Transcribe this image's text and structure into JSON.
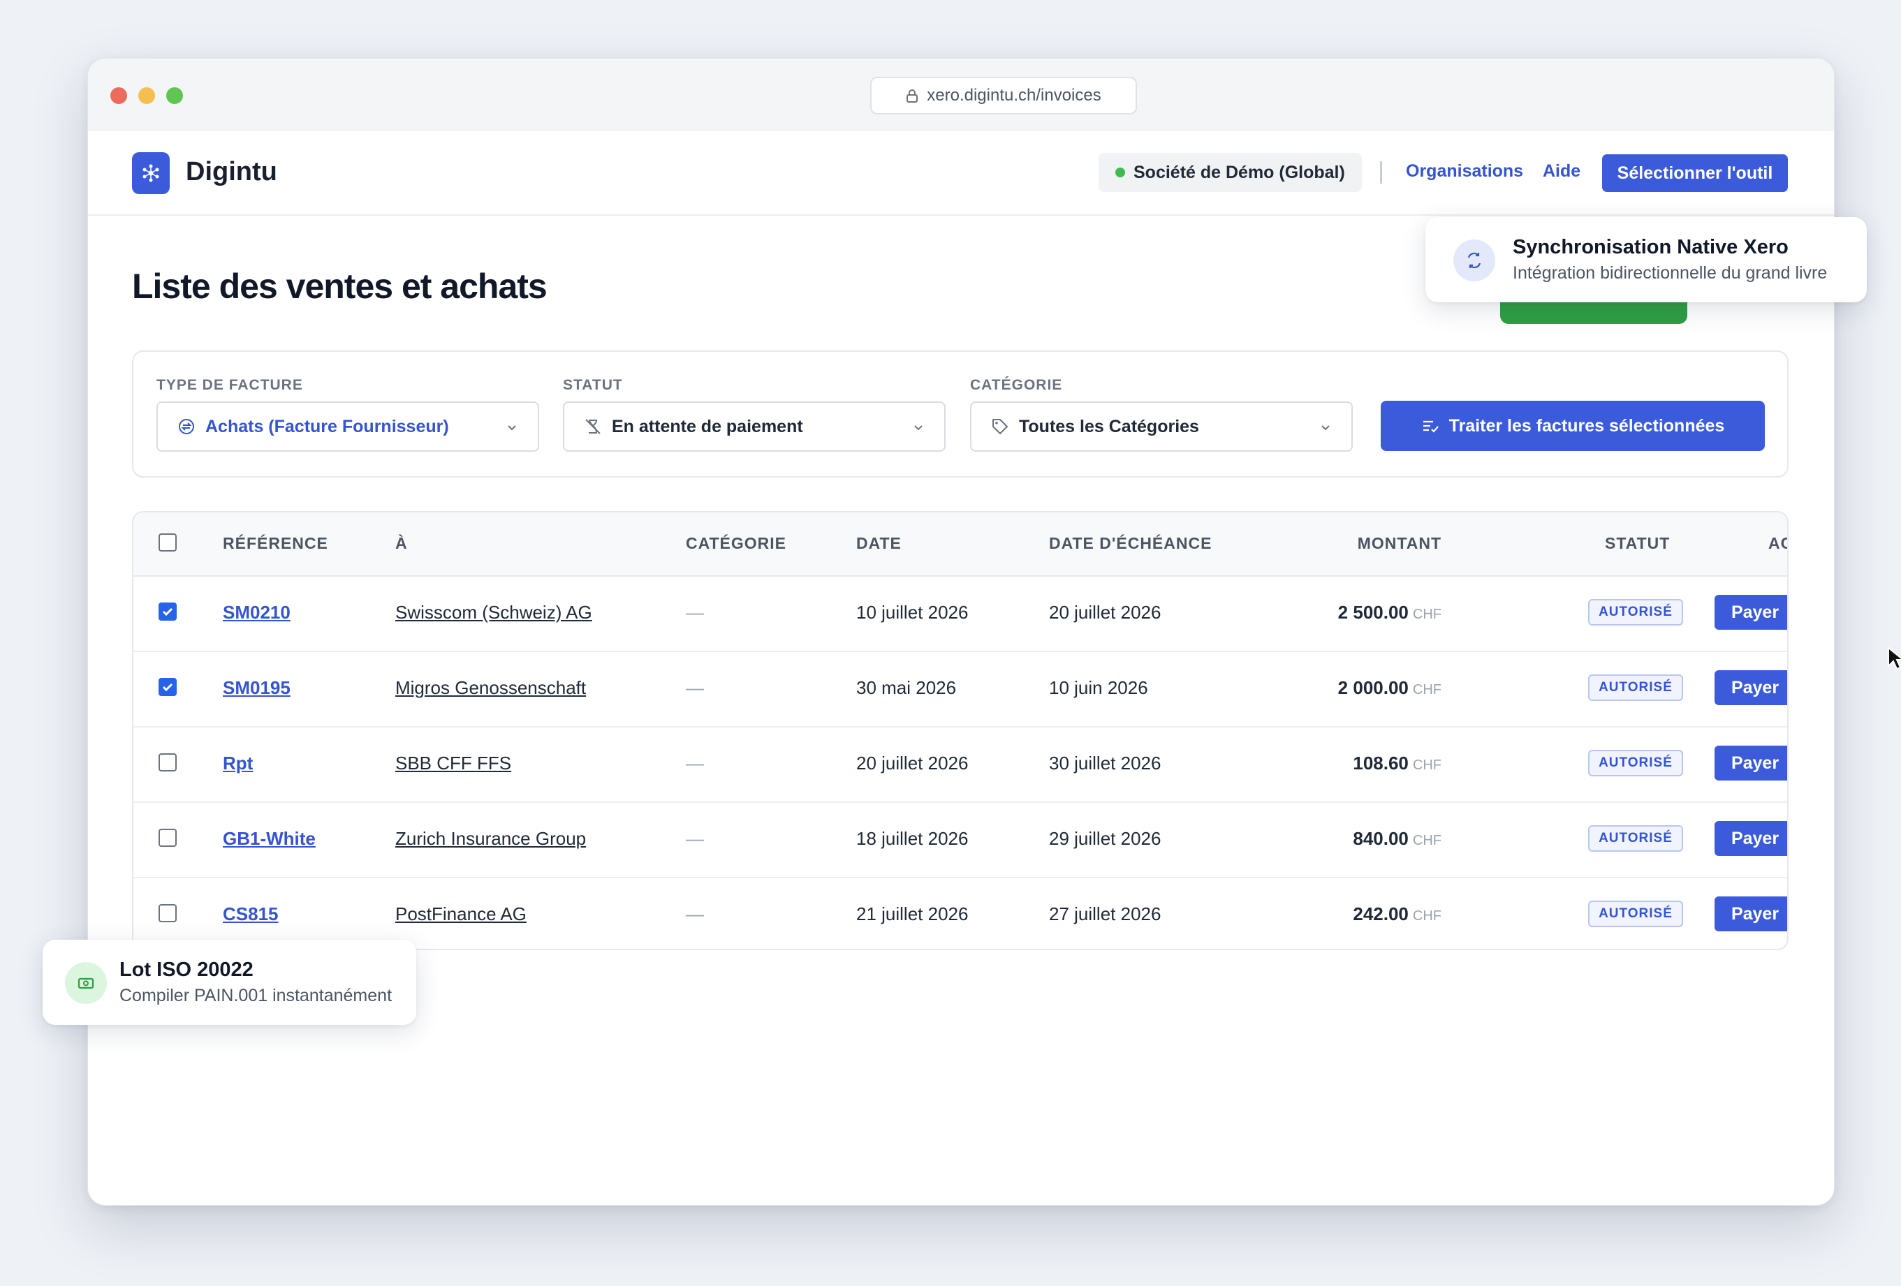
{
  "browser": {
    "url": "xero.digintu.ch/invoices"
  },
  "header": {
    "brand": "Digintu",
    "org": "Société de Démo (Global)",
    "links": {
      "organisations": "Organisations",
      "aide": "Aide"
    },
    "select_tool": "Sélectionner l'outil"
  },
  "page": {
    "title": "Liste des ventes et achats"
  },
  "filters": {
    "invoice_type": {
      "label": "TYPE DE FACTURE",
      "value": "Achats (Facture Fournisseur)"
    },
    "status": {
      "label": "STATUT",
      "value": "En attente de paiement"
    },
    "category": {
      "label": "CATÉGORIE",
      "value": "Toutes les Catégories"
    },
    "process_button": "Traiter les factures sélectionnées"
  },
  "table": {
    "headers": {
      "reference": "RÉFÉRENCE",
      "to": "À",
      "category": "CATÉGORIE",
      "date": "DATE",
      "due": "DATE D'ÉCHÉANCE",
      "amount": "MONTANT",
      "status": "STATUT",
      "action": "ACTION"
    },
    "rows": [
      {
        "checked": true,
        "ref": "SM0210",
        "to": "Swisscom (Schweiz) AG",
        "category": "—",
        "date": "10 juillet 2026",
        "due": "20 juillet 2026",
        "amount": "2 500.00",
        "currency": "CHF",
        "status": "AUTORISÉ",
        "action": "Payer"
      },
      {
        "checked": true,
        "ref": "SM0195",
        "to": "Migros Genossenschaft",
        "category": "—",
        "date": "30 mai 2026",
        "due": "10 juin 2026",
        "amount": "2 000.00",
        "currency": "CHF",
        "status": "AUTORISÉ",
        "action": "Payer"
      },
      {
        "checked": false,
        "ref": "Rpt",
        "to": "SBB CFF FFS",
        "category": "—",
        "date": "20 juillet 2026",
        "due": "30 juillet 2026",
        "amount": "108.60",
        "currency": "CHF",
        "status": "AUTORISÉ",
        "action": "Payer"
      },
      {
        "checked": false,
        "ref": "GB1-White",
        "to": "Zurich Insurance Group",
        "category": "—",
        "date": "18 juillet 2026",
        "due": "29 juillet 2026",
        "amount": "840.00",
        "currency": "CHF",
        "status": "AUTORISÉ",
        "action": "Payer"
      },
      {
        "checked": false,
        "ref": "CS815",
        "to": "PostFinance AG",
        "category": "—",
        "date": "21 juillet 2026",
        "due": "27 juillet 2026",
        "amount": "242.00",
        "currency": "CHF",
        "status": "AUTORISÉ",
        "action": "Payer"
      }
    ]
  },
  "floats": {
    "sync": {
      "title": "Synchronisation Native Xero",
      "subtitle": "Intégration bidirectionnelle du grand livre"
    },
    "iso": {
      "title": "Lot ISO 20022",
      "subtitle": "Compiler PAIN.001 instantanément"
    }
  },
  "colors": {
    "accent": "#3b5bdb",
    "success": "#3fb950",
    "badge_text": "#3454d1"
  }
}
